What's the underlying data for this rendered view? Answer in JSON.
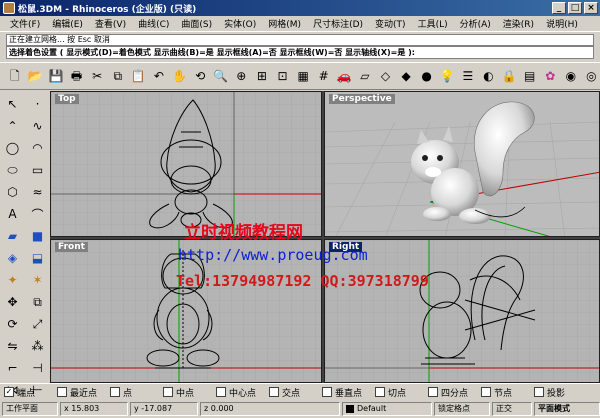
{
  "window": {
    "title": "松鼠.3DM - Rhinoceros (企业版) (只读)",
    "btn_min": "_",
    "btn_max": "□",
    "btn_close": "×"
  },
  "menu": [
    "文件(F)",
    "编辑(E)",
    "查看(V)",
    "曲线(C)",
    "曲面(S)",
    "实体(O)",
    "网格(M)",
    "尺寸标注(D)",
    "变动(T)",
    "工具(L)",
    "分析(A)",
    "渲染(R)",
    "说明(H)"
  ],
  "command": {
    "history": "正在建立网格... 按 Esc 取消",
    "prompt": "选择着色设置 ( 显示模式(D)=着色模式  显示曲线(B)=是  显示框线(A)=否  显示框线(W)=否  显示轴线(X)=是 ):"
  },
  "viewports": {
    "top": "Top",
    "perspective": "Perspective",
    "front": "Front",
    "right": "Right"
  },
  "watermark": {
    "line1": "立时视频教程网",
    "line2": "http://www.proeug.com",
    "line3": "Tel:13794987192  QQ:397318799"
  },
  "osnaps": [
    {
      "label": "端点",
      "checked": true
    },
    {
      "label": "最近点",
      "checked": false
    },
    {
      "label": "点",
      "checked": false
    },
    {
      "label": "中点",
      "checked": false
    },
    {
      "label": "中心点",
      "checked": false
    },
    {
      "label": "交点",
      "checked": false
    },
    {
      "label": "垂直点",
      "checked": false
    },
    {
      "label": "切点",
      "checked": false
    },
    {
      "label": "四分点",
      "checked": false
    },
    {
      "label": "节点",
      "checked": false
    },
    {
      "label": "投影",
      "checked": false
    }
  ],
  "status": {
    "cplane": "工作平面",
    "x": "x 15.803",
    "y": "y -17.087",
    "z": "z 0.000",
    "layer": "Default",
    "grid_snap": "锁定格点",
    "ortho": "正交",
    "planar": "平面模式"
  },
  "colors": {
    "titlebar": "#0a246a",
    "viewport_bg": "#b4b4b4",
    "grid_line": "#a0a0a0",
    "axis_x": "#c00000",
    "axis_y": "#00a000",
    "watermark_red": "#e8061c",
    "watermark_blue": "#0b22d0"
  }
}
